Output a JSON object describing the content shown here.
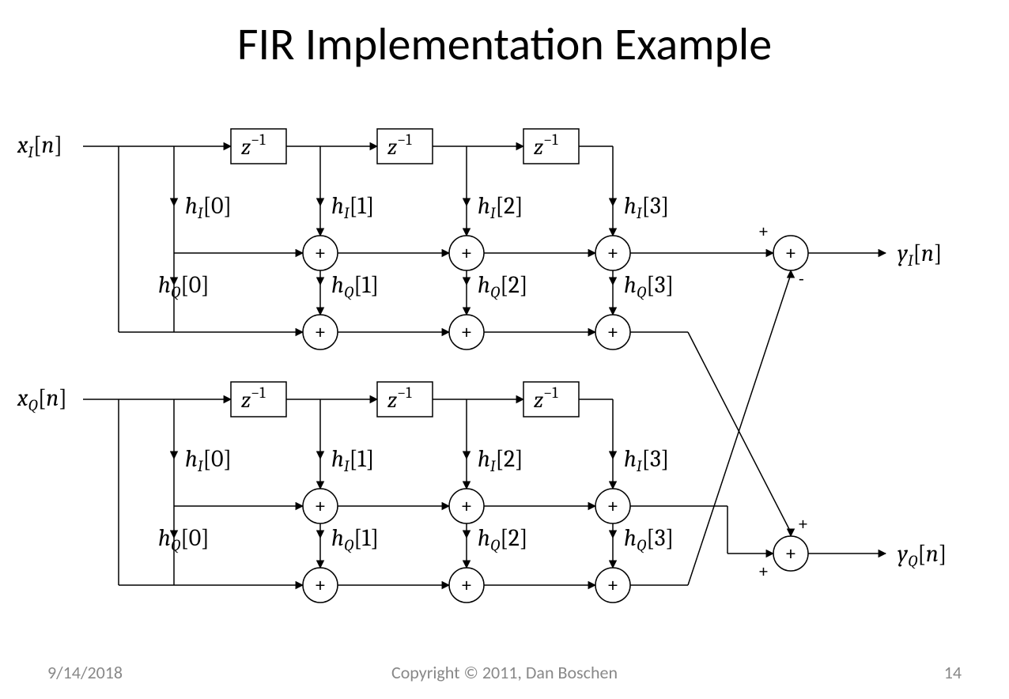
{
  "title": "FIR Implementation Example",
  "footer": {
    "date": "9/14/2018",
    "copyright": "Copyright © 2011, Dan Boschen",
    "page": "14"
  },
  "labels": {
    "xI": "x_I[n]",
    "xQ": "x_Q[n]",
    "yI": "y_I[n]",
    "yQ": "y_Q[n]",
    "z": "z^{-1}",
    "hI": [
      "h_I[0]",
      "h_I[1]",
      "h_I[2]",
      "h_I[3]"
    ],
    "hQ": [
      "h_Q[0]",
      "h_Q[1]",
      "h_Q[2]",
      "h_Q[3]"
    ],
    "plus": "+",
    "minus": "-"
  },
  "structure": {
    "filter_type": "4-tap complex FIR (direct form)",
    "branches": 2,
    "taps": 4,
    "output_yI": "sum(x_I * h_I) - sum(x_Q * h_Q)",
    "output_yQ": "sum(x_I * h_Q) + sum(x_Q * h_I)"
  }
}
